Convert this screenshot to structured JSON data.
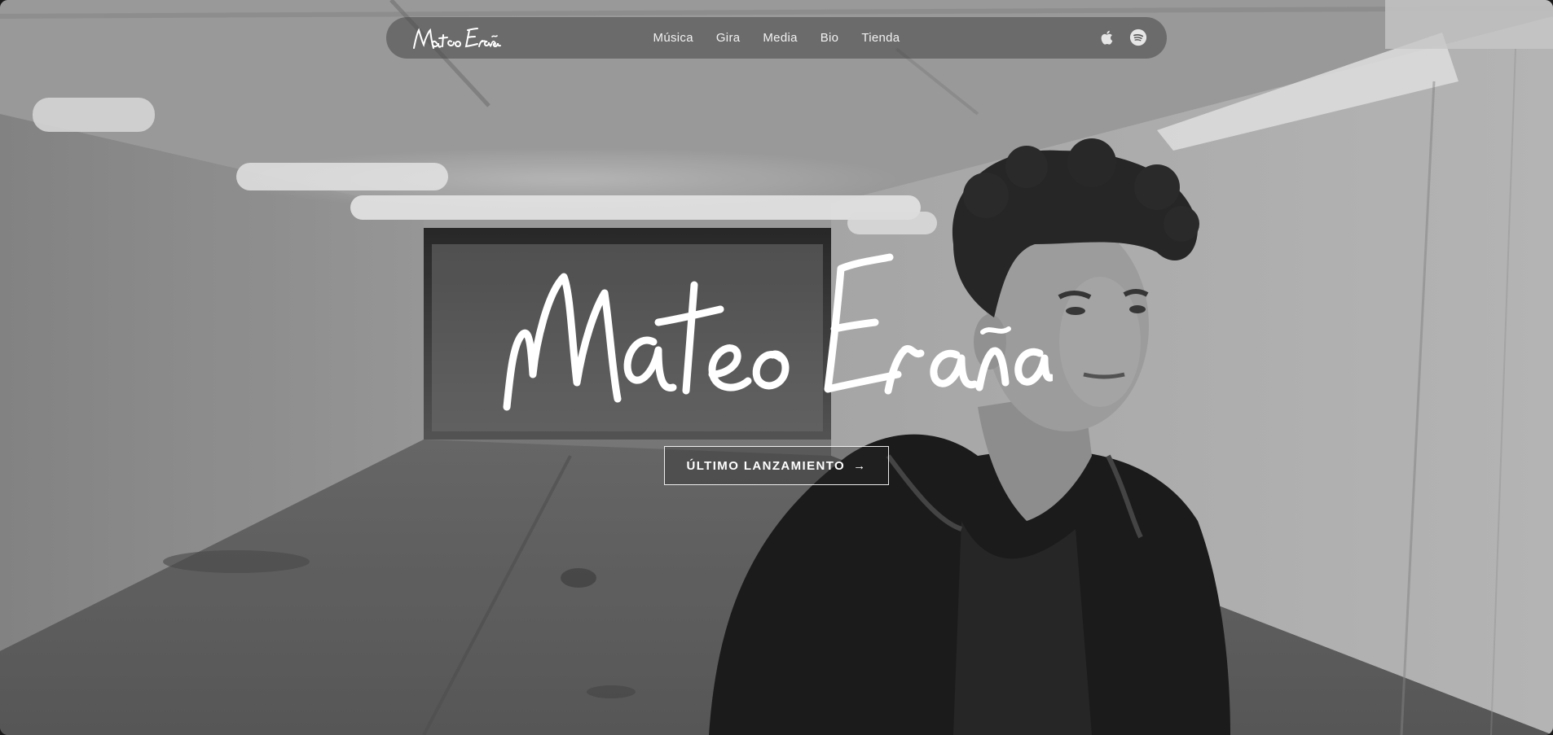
{
  "site": {
    "logo_text": "Mateo Eraña"
  },
  "nav": {
    "items": [
      {
        "label": "Música"
      },
      {
        "label": "Gira"
      },
      {
        "label": "Media"
      },
      {
        "label": "Bio"
      },
      {
        "label": "Tienda"
      }
    ],
    "icons": [
      "apple-music-icon",
      "spotify-icon"
    ]
  },
  "hero": {
    "signature_text": "Mateo Eraña",
    "cta_label": "ÚLTIMO LANZAMIENTO",
    "cta_arrow": "→"
  },
  "colors": {
    "nav_background": "#464646",
    "text": "#ffffff",
    "photo_tone": "grayscale"
  }
}
